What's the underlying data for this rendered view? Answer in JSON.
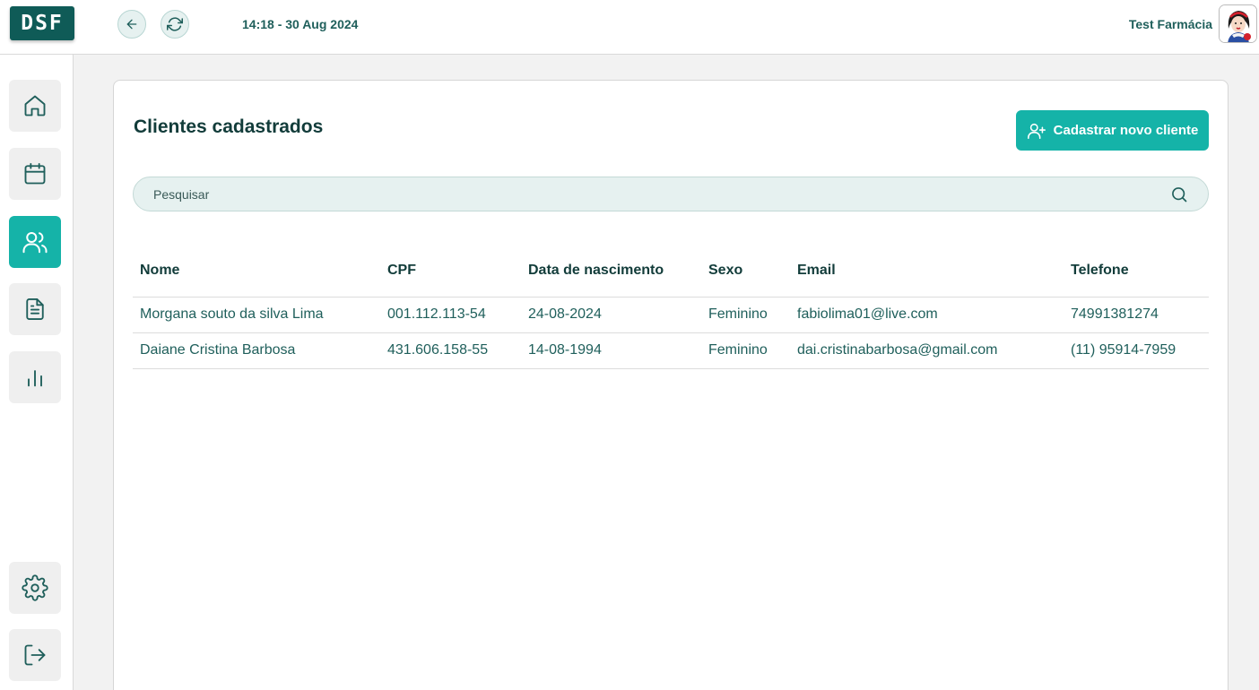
{
  "app": {
    "logo_text": "DSF",
    "datetime": "14:18 - 30 Aug 2024",
    "user_name": "Test Farmácia"
  },
  "icons": {
    "back": "arrow-left-icon",
    "refresh": "refresh-icon",
    "home": "home-icon",
    "calendar": "calendar-icon",
    "clients": "users-icon",
    "reports": "document-icon",
    "stats": "bar-chart-icon",
    "settings": "gear-icon",
    "logout": "logout-icon",
    "search": "search-icon",
    "add_user": "user-plus-icon"
  },
  "colors": {
    "accent": "#15b3a8",
    "brand_dark": "#0f5b57",
    "text_primary": "#123c3a",
    "text_secondary": "#1f5f5b"
  },
  "page": {
    "title": "Clientes cadastrados",
    "new_client_label": "Cadastrar novo cliente",
    "search_placeholder": "Pesquisar"
  },
  "table": {
    "headers": [
      "Nome",
      "CPF",
      "Data de nascimento",
      "Sexo",
      "Email",
      "Telefone"
    ],
    "rows": [
      [
        "Morgana souto da silva Lima",
        "001.112.113-54",
        "24-08-2024",
        "Feminino",
        "fabiolima01@live.com",
        "74991381274"
      ],
      [
        "Daiane Cristina Barbosa",
        "431.606.158-55",
        "14-08-1994",
        "Feminino",
        "dai.cristinabarbosa@gmail.com",
        "(11) 95914-7959"
      ]
    ]
  }
}
